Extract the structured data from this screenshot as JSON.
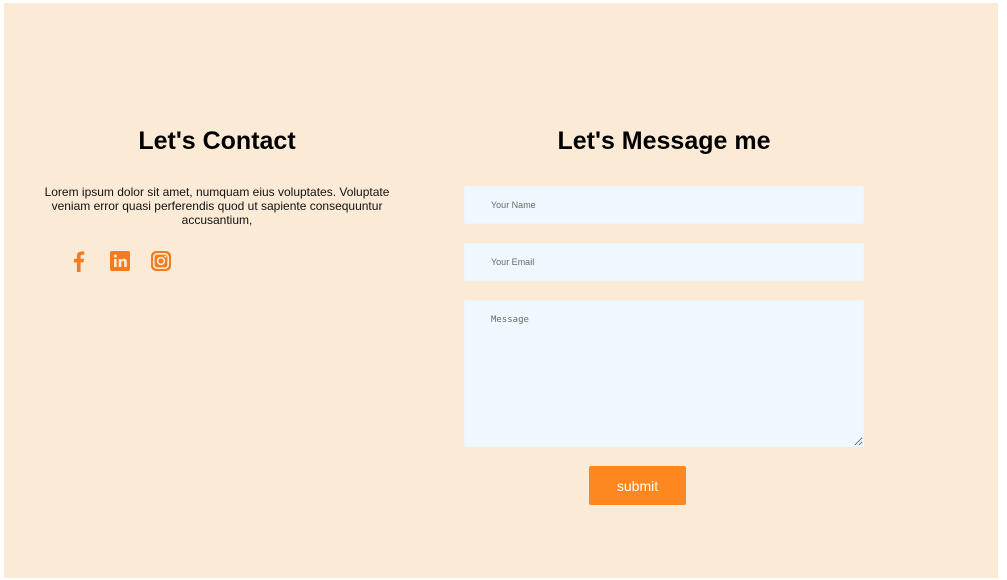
{
  "contact": {
    "heading": "Let's Contact",
    "description": "Lorem ipsum dolor sit amet, numquam eius voluptates. Voluptate veniam error quasi perferendis quod ut sapiente consequuntur accusantium,",
    "socials": [
      {
        "icon": "facebook-icon"
      },
      {
        "icon": "linkedin-icon"
      },
      {
        "icon": "instagram-icon"
      }
    ]
  },
  "message_form": {
    "heading": "Let's Message me",
    "name_placeholder": "Your Name",
    "email_placeholder": "Your Email",
    "message_placeholder": "Message",
    "submit_label": "submit"
  },
  "colors": {
    "page_background": "#fbebd6",
    "input_background": "#eff7ff",
    "accent": "#fe8720",
    "icon": "#f47c20"
  }
}
